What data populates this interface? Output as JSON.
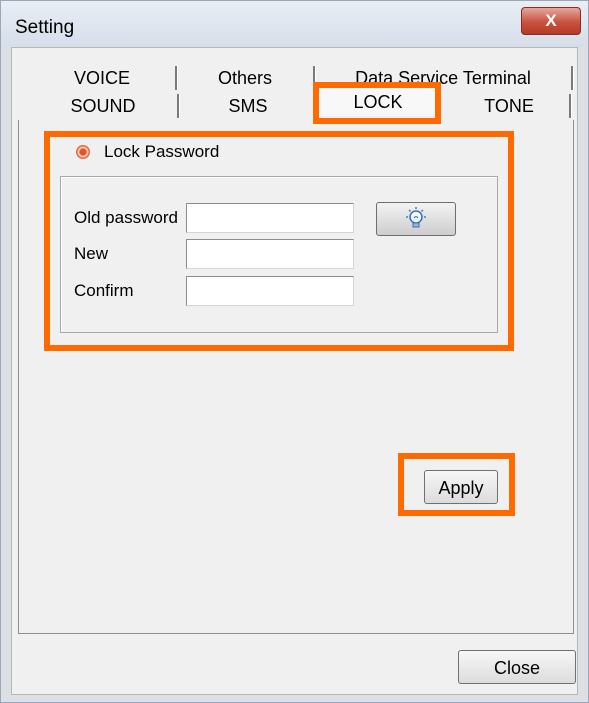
{
  "window": {
    "title": "Setting",
    "close_glyph": "X"
  },
  "tabs": {
    "row1": [
      "VOICE",
      "Others",
      "Data Service Terminal"
    ],
    "row2": [
      "SOUND",
      "SMS",
      "LOCK",
      "TONE"
    ]
  },
  "lock": {
    "group_label": "Lock Password",
    "fields": [
      {
        "label": "Old password",
        "value": ""
      },
      {
        "label": "New",
        "value": ""
      },
      {
        "label": "Confirm",
        "value": ""
      }
    ],
    "hint_icon": "lightbulb-icon"
  },
  "buttons": {
    "apply": "Apply",
    "close": "Close"
  },
  "colors": {
    "highlight": "#ff6a00",
    "radio": "#e0522a"
  }
}
